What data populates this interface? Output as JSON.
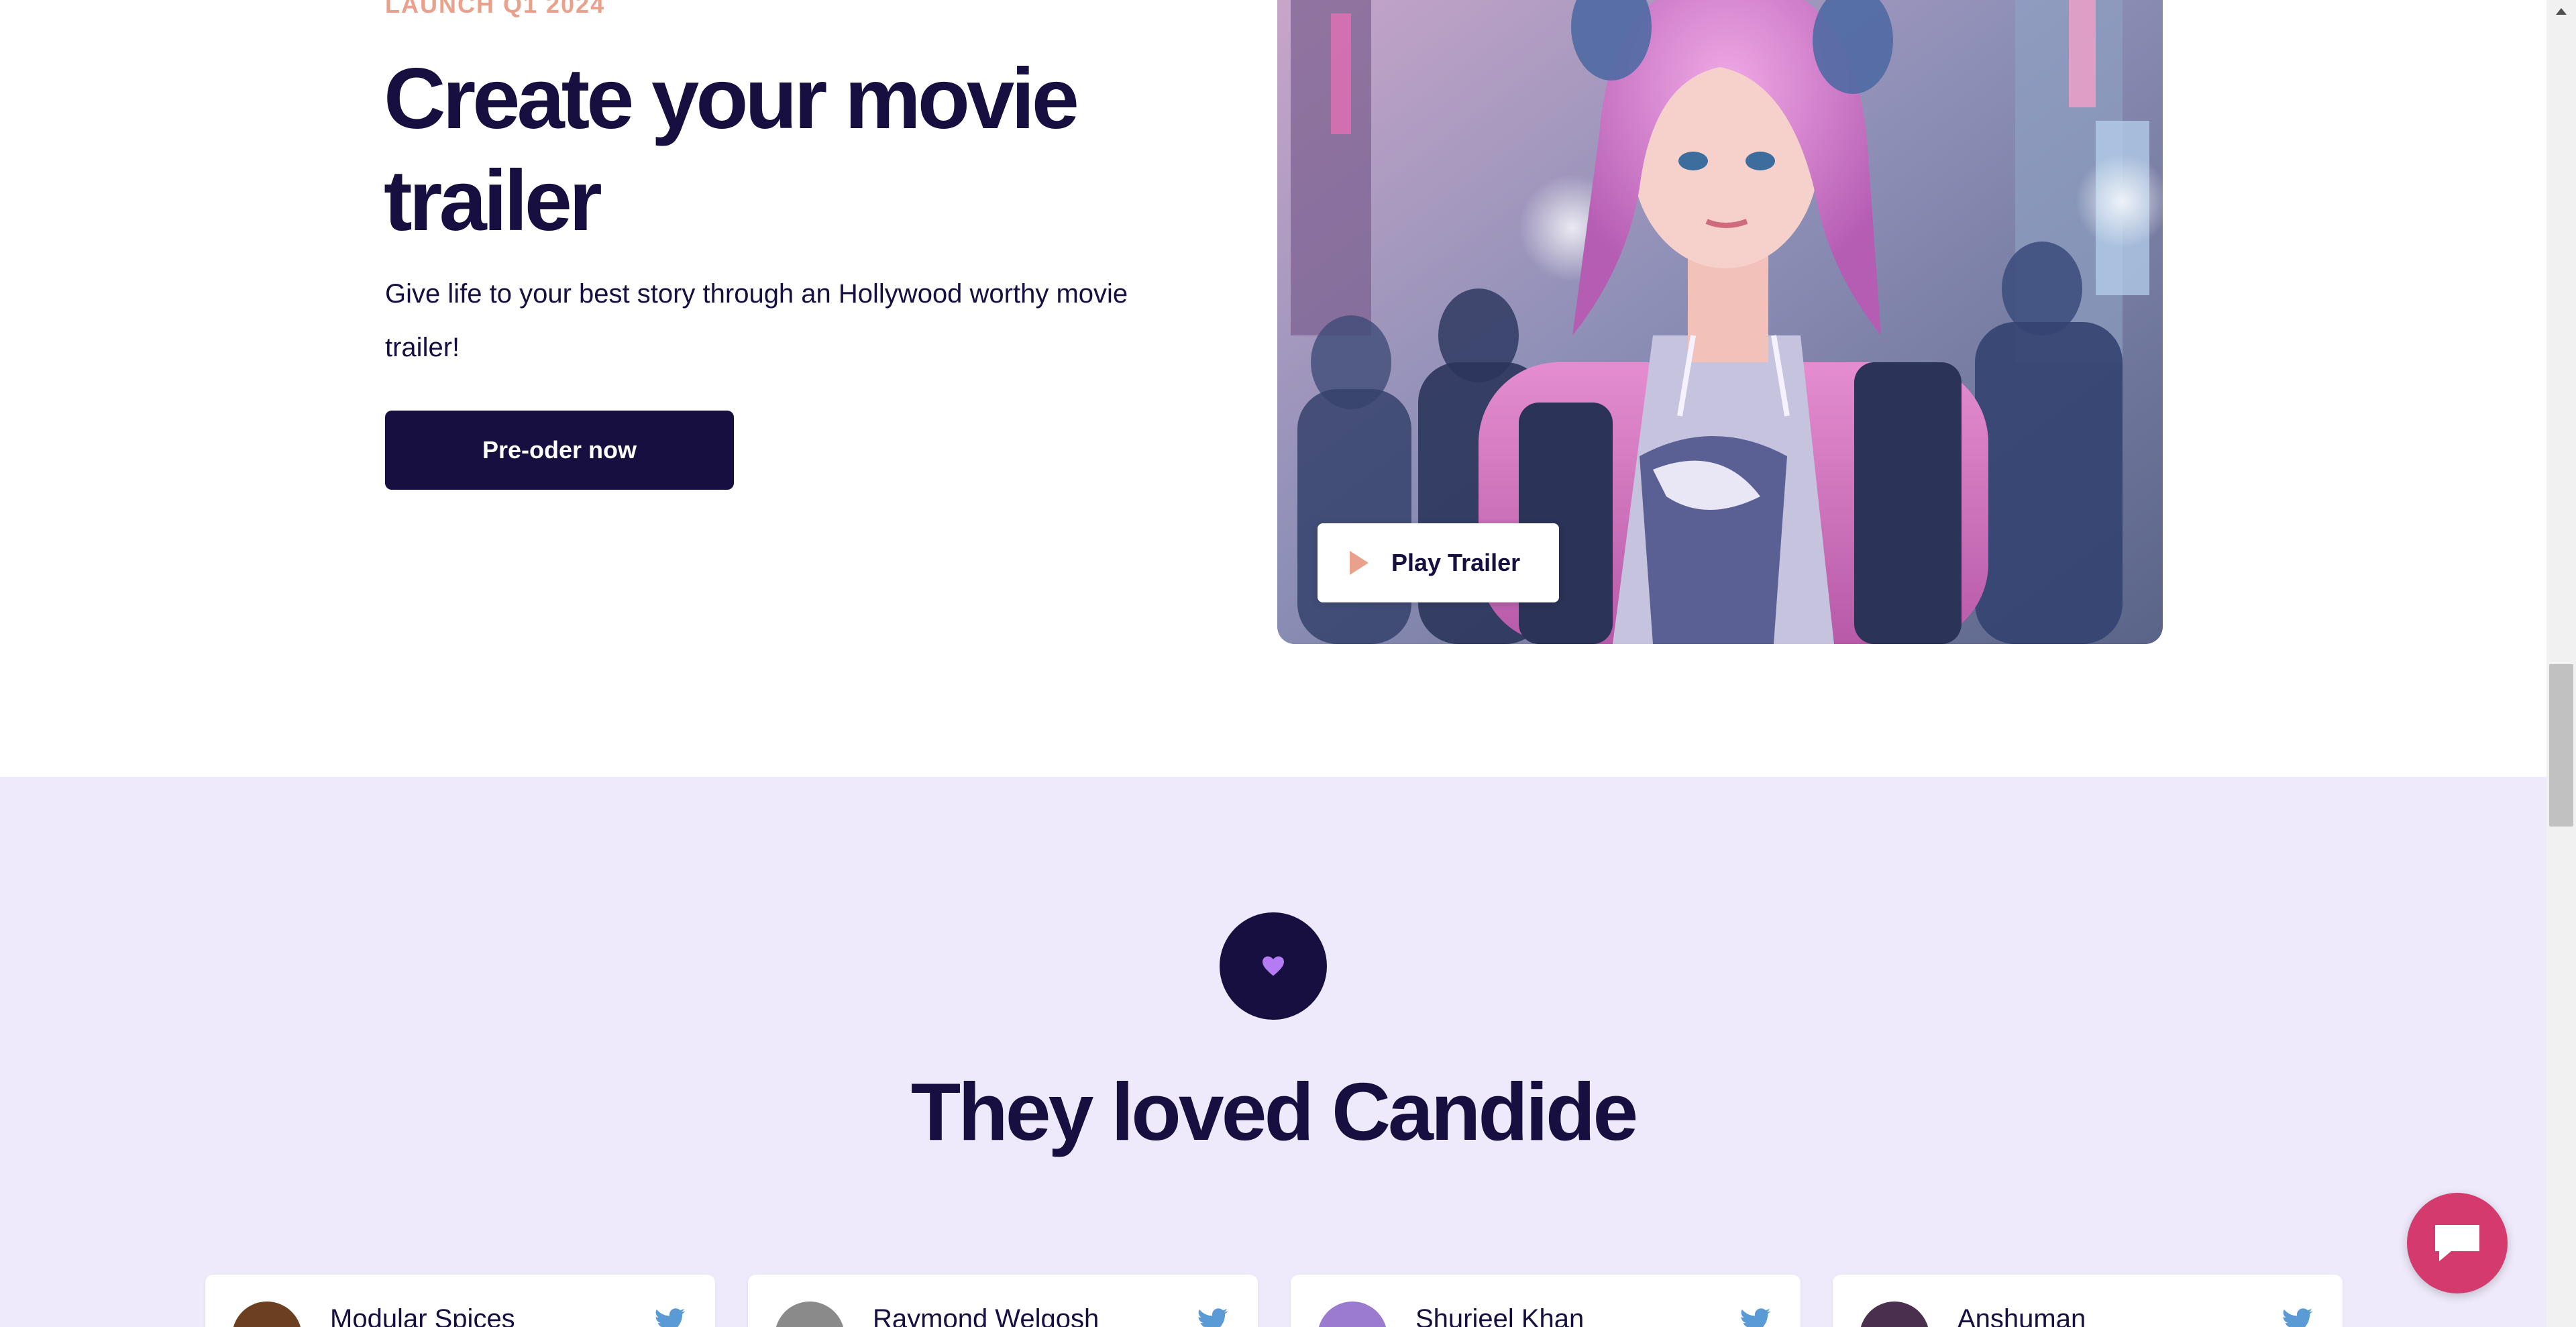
{
  "hero": {
    "eyebrow": "LAUNCH Q1 2024",
    "title": "Create your movie trailer",
    "description": "Give life to your best story through an Hollywood worthy movie trailer!",
    "cta_label": "Pre-oder now",
    "play_label": "Play Trailer",
    "play_icon": "play-icon",
    "image_alt": "anime-girl-pink-hair-headphones-illustration"
  },
  "testimonials": {
    "badge_icon": "heart-icon",
    "title": "They loved Candide",
    "cards": [
      {
        "name": "Modular Spices",
        "icon": "twitter-icon"
      },
      {
        "name": "Raymond Welgosh",
        "icon": "twitter-icon"
      },
      {
        "name": "Shurjeel Khan",
        "icon": "twitter-icon"
      },
      {
        "name": "Anshuman",
        "icon": "twitter-icon"
      }
    ]
  },
  "chat": {
    "icon": "chat-icon"
  },
  "colors": {
    "brand_dark": "#160f3f",
    "accent_peach": "#eaa18c",
    "section_bg": "#eeeafb",
    "heart": "#b57bf2",
    "twitter": "#5b9bd5",
    "chat": "#d43a6d"
  }
}
